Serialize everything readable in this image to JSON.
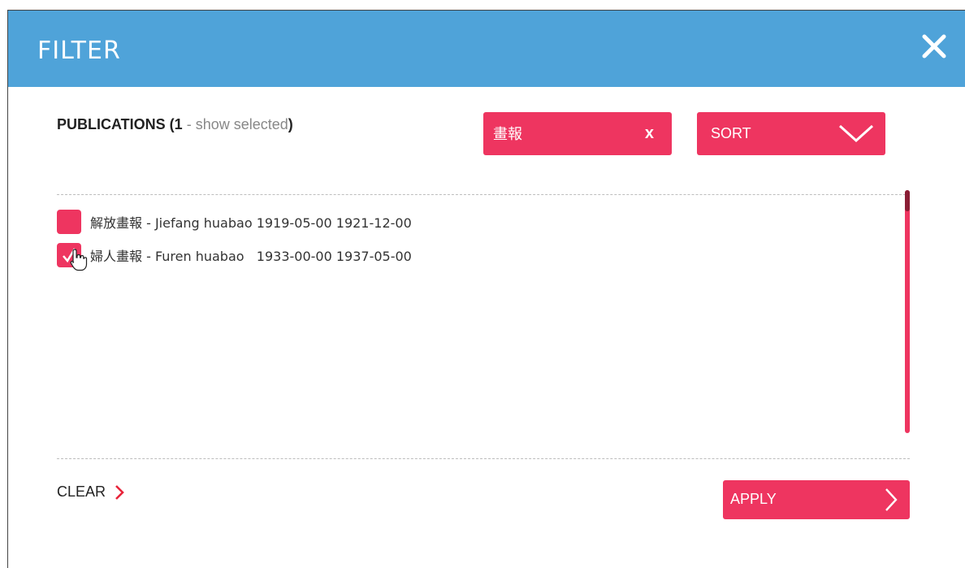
{
  "modal": {
    "title": "FILTER"
  },
  "publications": {
    "label": "PUBLICATIONS (",
    "count": "1",
    "dash": " - ",
    "show_selected": "show selected",
    "close_paren": ")"
  },
  "search": {
    "value": "畫報",
    "clear_label": "x"
  },
  "sort": {
    "label": "SORT"
  },
  "items": [
    {
      "label": "解放畫報 - Jiefang huabao 1919-05-00 1921-12-00",
      "checked": false
    },
    {
      "label": "婦人畫報 - Furen huabao   1933-00-00 1937-05-00",
      "checked": true
    }
  ],
  "footer": {
    "clear_label": "CLEAR",
    "apply_label": "APPLY"
  },
  "colors": {
    "header": "#4fa3d9",
    "accent": "#ee3560",
    "scroll_thumb": "#8a1e35"
  }
}
